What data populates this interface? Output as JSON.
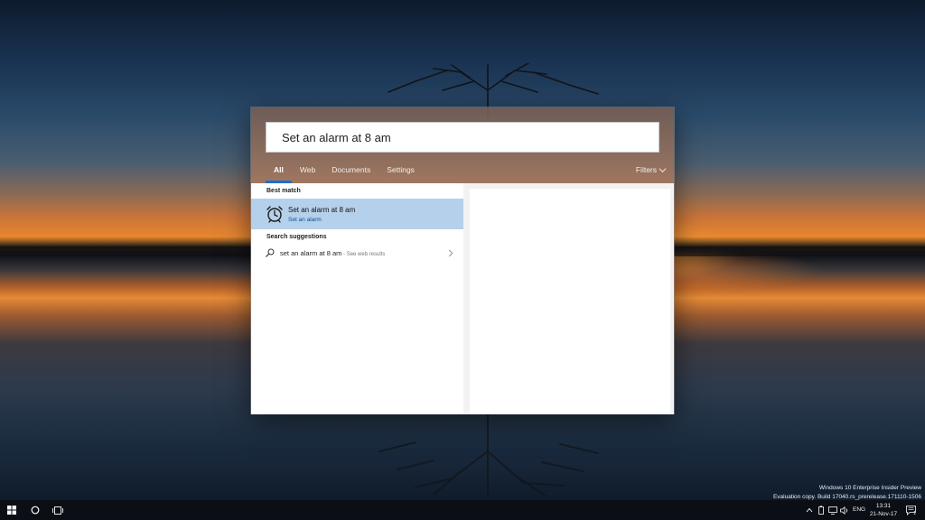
{
  "search": {
    "query": "Set an alarm at 8 am"
  },
  "tabs": [
    {
      "label": "All",
      "active": true
    },
    {
      "label": "Web",
      "active": false
    },
    {
      "label": "Documents",
      "active": false
    },
    {
      "label": "Settings",
      "active": false
    }
  ],
  "filters_label": "Filters",
  "best_match": {
    "section_label": "Best match",
    "title": "Set an alarm at 8 am",
    "subtitle": "Set an alarm",
    "icon": "alarm-clock-icon"
  },
  "suggestions": {
    "section_label": "Search suggestions",
    "items": [
      {
        "text": "set an alarm at 8 am",
        "sub": " - See web results",
        "icon": "search-icon"
      }
    ]
  },
  "watermark": {
    "line1": "Windows 10 Enterprise Insider Preview",
    "line2": "Evaluation copy. Build 17040.rs_prerelease.171110-1506"
  },
  "tray": {
    "language": "ENG",
    "time": "13:31",
    "date": "21-Nov-17",
    "notification_count": "1"
  },
  "colors": {
    "accent": "#1c6fd1",
    "selected_row": "#b5d0ea",
    "taskbar": "#0c0e14"
  }
}
